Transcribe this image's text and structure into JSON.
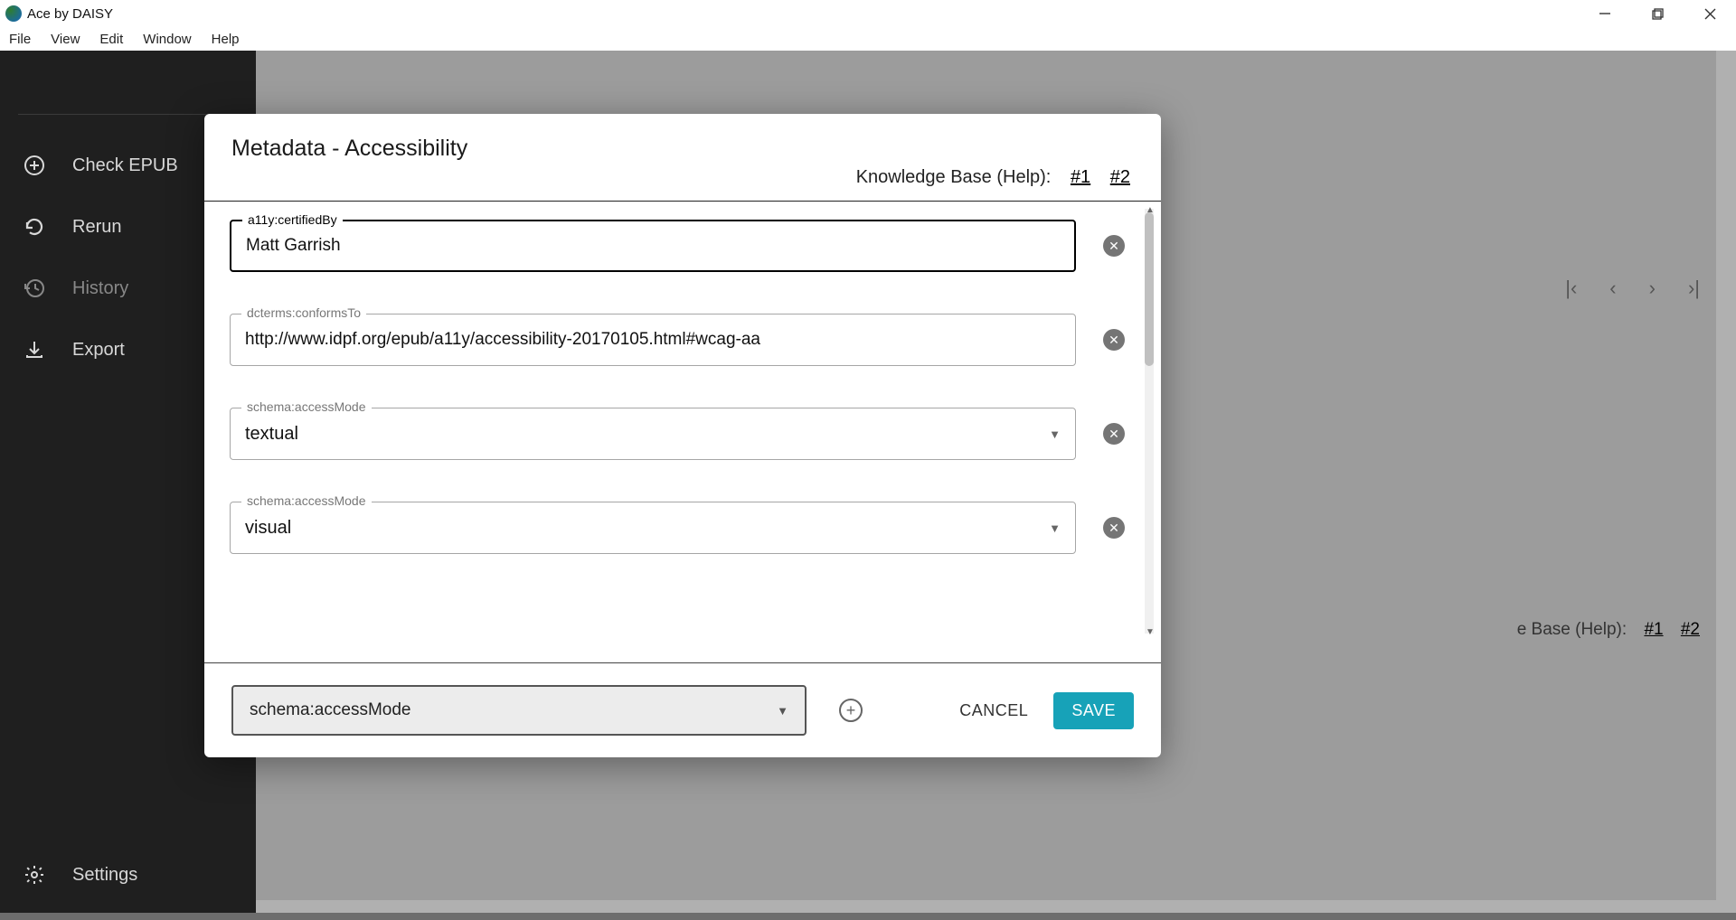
{
  "window": {
    "title": "Ace by DAISY"
  },
  "menubar": {
    "items": [
      "File",
      "View",
      "Edit",
      "Window",
      "Help"
    ]
  },
  "sidebar": {
    "items": [
      {
        "label": "Check EPUB",
        "icon": "plus"
      },
      {
        "label": "Rerun",
        "icon": "refresh"
      },
      {
        "label": "History",
        "icon": "history",
        "dim": true
      },
      {
        "label": "Export",
        "icon": "download"
      }
    ],
    "settings": "Settings"
  },
  "background": {
    "help_label": "e Base (Help):",
    "help_links": [
      "#1",
      "#2"
    ]
  },
  "modal": {
    "title": "Metadata - Accessibility",
    "help_label": "Knowledge Base (Help):",
    "help_links": [
      "#1",
      "#2"
    ],
    "fields": [
      {
        "label": "a11y:certifiedBy",
        "type": "text",
        "value": "Matt Garrish",
        "focused": true
      },
      {
        "label": "dcterms:conformsTo",
        "type": "text",
        "value": "http://www.idpf.org/epub/a11y/accessibility-20170105.html#wcag-aa"
      },
      {
        "label": "schema:accessMode",
        "type": "select",
        "value": "textual"
      },
      {
        "label": "schema:accessMode",
        "type": "select",
        "value": "visual"
      }
    ],
    "footer": {
      "add_select": "schema:accessMode",
      "cancel": "CANCEL",
      "save": "SAVE"
    }
  }
}
